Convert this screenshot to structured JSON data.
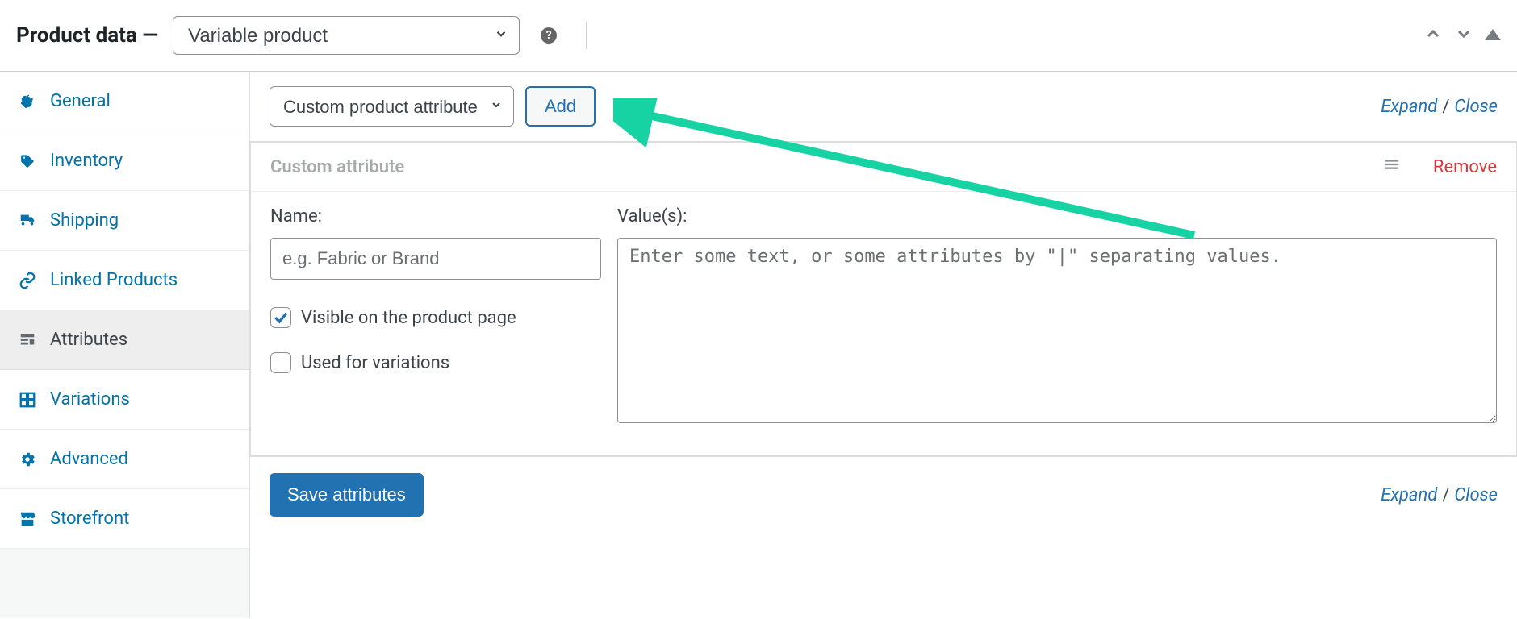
{
  "header": {
    "title": "Product data —",
    "product_type": "Variable product",
    "help_icon": "?"
  },
  "sidebar": {
    "items": [
      {
        "label": "General"
      },
      {
        "label": "Inventory"
      },
      {
        "label": "Shipping"
      },
      {
        "label": "Linked Products"
      },
      {
        "label": "Attributes"
      },
      {
        "label": "Variations"
      },
      {
        "label": "Advanced"
      },
      {
        "label": "Storefront"
      }
    ]
  },
  "toolbar": {
    "attribute_select": "Custom product attribute",
    "add_label": "Add",
    "expand": "Expand",
    "sep": " / ",
    "close": "Close"
  },
  "attribute_card": {
    "title": "Custom attribute",
    "remove": "Remove",
    "name_label": "Name:",
    "name_placeholder": "e.g. Fabric or Brand",
    "values_label": "Value(s):",
    "values_placeholder": "Enter some text, or some attributes by \"|\" separating values.",
    "visible_label": "Visible on the product page",
    "used_variations_label": "Used for variations"
  },
  "footer": {
    "save_label": "Save attributes",
    "expand": "Expand",
    "sep": " / ",
    "close": "Close"
  }
}
